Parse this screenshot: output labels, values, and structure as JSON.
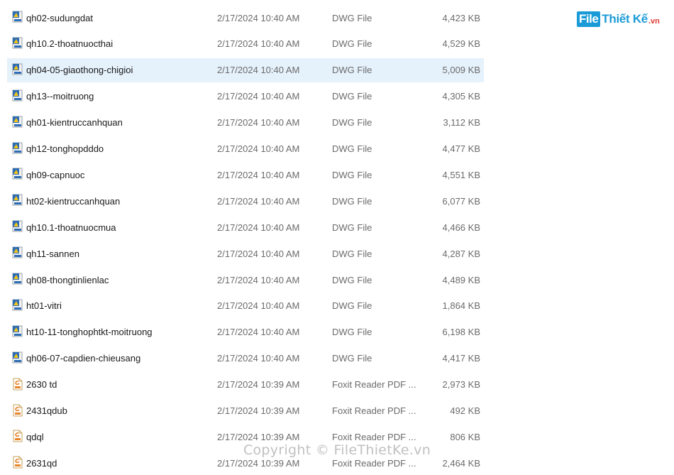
{
  "logo": {
    "box_text": "File",
    "text": "Thiết Kế",
    "suffix": ".vn"
  },
  "watermark": "Copyright © FileThietKe.vn",
  "files": [
    {
      "name": "qh02-sudungdat",
      "date": "2/17/2024 10:40 AM",
      "type": "DWG File",
      "size": "4,423 KB",
      "icon": "dwg-file-icon"
    },
    {
      "name": "qh10.2-thoatnuocthai",
      "date": "2/17/2024 10:40 AM",
      "type": "DWG File",
      "size": "4,529 KB",
      "icon": "dwg-file-icon"
    },
    {
      "name": "qh04-05-giaothong-chigioi",
      "date": "2/17/2024 10:40 AM",
      "type": "DWG File",
      "size": "5,009 KB",
      "icon": "dwg-file-icon",
      "selected": true
    },
    {
      "name": "qh13--moitruong",
      "date": "2/17/2024 10:40 AM",
      "type": "DWG File",
      "size": "4,305 KB",
      "icon": "dwg-file-icon"
    },
    {
      "name": "qh01-kientruccanhquan",
      "date": "2/17/2024 10:40 AM",
      "type": "DWG File",
      "size": "3,112 KB",
      "icon": "dwg-file-icon"
    },
    {
      "name": "qh12-tonghopdddo",
      "date": "2/17/2024 10:40 AM",
      "type": "DWG File",
      "size": "4,477 KB",
      "icon": "dwg-file-icon"
    },
    {
      "name": "qh09-capnuoc",
      "date": "2/17/2024 10:40 AM",
      "type": "DWG File",
      "size": "4,551 KB",
      "icon": "dwg-file-icon"
    },
    {
      "name": "ht02-kientruccanhquan",
      "date": "2/17/2024 10:40 AM",
      "type": "DWG File",
      "size": "6,077 KB",
      "icon": "dwg-file-icon"
    },
    {
      "name": "qh10.1-thoatnuocmua",
      "date": "2/17/2024 10:40 AM",
      "type": "DWG File",
      "size": "4,466 KB",
      "icon": "dwg-file-icon"
    },
    {
      "name": "qh11-sannen",
      "date": "2/17/2024 10:40 AM",
      "type": "DWG File",
      "size": "4,287 KB",
      "icon": "dwg-file-icon"
    },
    {
      "name": "qh08-thongtinlienlac",
      "date": "2/17/2024 10:40 AM",
      "type": "DWG File",
      "size": "4,489 KB",
      "icon": "dwg-file-icon"
    },
    {
      "name": "ht01-vitri",
      "date": "2/17/2024 10:40 AM",
      "type": "DWG File",
      "size": "1,864 KB",
      "icon": "dwg-file-icon"
    },
    {
      "name": "ht10-11-tonghophtkt-moitruong",
      "date": "2/17/2024 10:40 AM",
      "type": "DWG File",
      "size": "6,198 KB",
      "icon": "dwg-file-icon"
    },
    {
      "name": "qh06-07-capdien-chieusang",
      "date": "2/17/2024 10:40 AM",
      "type": "DWG File",
      "size": "4,417 KB",
      "icon": "dwg-file-icon"
    },
    {
      "name": "2630 td",
      "date": "2/17/2024 10:39 AM",
      "type": "Foxit Reader PDF ...",
      "size": "2,973 KB",
      "icon": "pdf-file-icon"
    },
    {
      "name": "2431qdub",
      "date": "2/17/2024 10:39 AM",
      "type": "Foxit Reader PDF ...",
      "size": "492 KB",
      "icon": "pdf-file-icon"
    },
    {
      "name": "qdql",
      "date": "2/17/2024 10:39 AM",
      "type": "Foxit Reader PDF ...",
      "size": "806 KB",
      "icon": "pdf-file-icon"
    },
    {
      "name": "2631qd",
      "date": "2/17/2024 10:39 AM",
      "type": "Foxit Reader PDF ...",
      "size": "2,464 KB",
      "icon": "pdf-file-icon"
    }
  ]
}
